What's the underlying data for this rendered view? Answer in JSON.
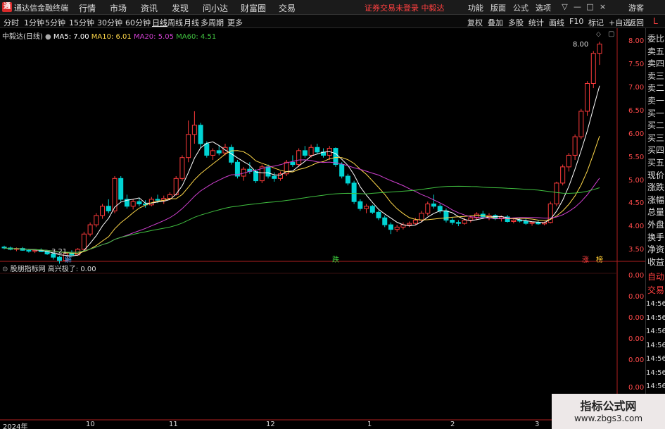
{
  "app": {
    "title": "通达信金融终端",
    "logo_text": "通"
  },
  "menu": [
    "行情",
    "市场",
    "资讯",
    "发现",
    "问小达",
    "财富圈",
    "交易"
  ],
  "notice": "证券交易未登录  中毅达",
  "right_menu": [
    "功能",
    "版面",
    "公式",
    "选项"
  ],
  "user": "游客",
  "window_controls": [
    "▽",
    "—",
    "□",
    "×"
  ],
  "periods": [
    "分时",
    "1分钟",
    "5分钟",
    "15分钟",
    "30分钟",
    "60分钟",
    "日线",
    "周线",
    "月线",
    "多周期",
    "更多"
  ],
  "toolbar": [
    "复权",
    "叠加",
    "多股",
    "统计",
    "画线",
    "F10",
    "标记",
    "+自选",
    "返回"
  ],
  "l_button": "L",
  "info": {
    "stock": "中毅达(日线)",
    "ma5": "MA5: 7.00",
    "ma10": "MA10: 6.01",
    "ma20": "MA20: 5.05",
    "ma60": "MA60: 4.51",
    "max_label": "8.00",
    "min_label": "3.21"
  },
  "price_axis": [
    "8.00",
    "7.50",
    "7.00",
    "6.50",
    "6.00",
    "5.50",
    "5.00",
    "4.50",
    "4.00",
    "3.50"
  ],
  "indicator": {
    "name": "股朋指标网",
    "value_text": "高兴极了: 0.00",
    "axis": [
      "0.00",
      "0.00",
      "0.00",
      "0.00",
      "0.00",
      "0.00"
    ]
  },
  "sidebar_top": [
    "委比",
    "卖五",
    "卖四",
    "卖三",
    "卖二",
    "卖一",
    "买一",
    "买二",
    "买三",
    "买四",
    "买五",
    "现价",
    "涨跌",
    "涨幅",
    "总量",
    "外盘",
    "换手",
    "净资",
    "收益"
  ],
  "sidebar_bottom": [
    "自动",
    "交易"
  ],
  "times": [
    "14:56",
    "14:56",
    "14:56",
    "14:56",
    "14:56",
    "14:56",
    "14:56",
    "14:56",
    "14:56"
  ],
  "dates": [
    "2024年",
    "10",
    "11",
    "12",
    "1",
    "2",
    "3"
  ],
  "markers": [
    {
      "text": "解",
      "color": "#4aa8ff"
    },
    {
      "text": "跌",
      "color": "#3ccc3c"
    },
    {
      "text": "涨",
      "color": "#ff4040"
    },
    {
      "text": "榜",
      "color": "#ffcc33"
    }
  ],
  "colors": {
    "up": "#ff3b3b",
    "down": "#00d4d4",
    "ma5": "#ffffff",
    "ma10": "#ffd84a",
    "ma20": "#d040d0",
    "ma60": "#40c040",
    "axis": "#ff4a4a"
  },
  "chart_data": {
    "type": "candlestick",
    "y_range": [
      3.2,
      8.05
    ],
    "candles": [
      [
        3.57,
        3.6,
        3.52,
        3.55
      ],
      [
        3.55,
        3.58,
        3.5,
        3.52
      ],
      [
        3.52,
        3.56,
        3.48,
        3.54
      ],
      [
        3.54,
        3.57,
        3.49,
        3.5
      ],
      [
        3.5,
        3.53,
        3.45,
        3.48
      ],
      [
        3.48,
        3.52,
        3.44,
        3.5
      ],
      [
        3.5,
        3.54,
        3.46,
        3.47
      ],
      [
        3.47,
        3.49,
        3.4,
        3.42
      ],
      [
        3.42,
        3.46,
        3.3,
        3.35
      ],
      [
        3.35,
        3.38,
        3.21,
        3.28
      ],
      [
        3.28,
        3.45,
        3.26,
        3.43
      ],
      [
        3.43,
        3.5,
        3.38,
        3.4
      ],
      [
        3.4,
        3.55,
        3.38,
        3.52
      ],
      [
        3.52,
        3.9,
        3.5,
        3.85
      ],
      [
        3.85,
        4.1,
        3.8,
        4.05
      ],
      [
        4.05,
        4.3,
        4.0,
        4.25
      ],
      [
        4.25,
        4.5,
        4.18,
        4.45
      ],
      [
        4.45,
        4.6,
        4.3,
        4.35
      ],
      [
        4.35,
        5.1,
        4.3,
        5.05
      ],
      [
        5.05,
        5.1,
        4.55,
        4.6
      ],
      [
        4.6,
        4.7,
        4.4,
        4.45
      ],
      [
        4.45,
        4.6,
        4.38,
        4.55
      ],
      [
        4.55,
        4.62,
        4.45,
        4.5
      ],
      [
        4.5,
        4.58,
        4.42,
        4.48
      ],
      [
        4.48,
        4.65,
        4.45,
        4.6
      ],
      [
        4.6,
        4.7,
        4.52,
        4.58
      ],
      [
        4.58,
        4.68,
        4.5,
        4.62
      ],
      [
        4.62,
        4.75,
        4.58,
        4.7
      ],
      [
        4.7,
        5.1,
        4.68,
        5.05
      ],
      [
        5.05,
        5.55,
        5.0,
        5.5
      ],
      [
        5.5,
        6.3,
        5.4,
        6.0
      ],
      [
        6.0,
        6.5,
        5.8,
        6.2
      ],
      [
        6.2,
        6.25,
        5.7,
        5.8
      ],
      [
        5.8,
        5.85,
        5.5,
        5.55
      ],
      [
        5.55,
        5.7,
        5.45,
        5.65
      ],
      [
        5.65,
        5.75,
        5.55,
        5.6
      ],
      [
        5.6,
        5.8,
        5.55,
        5.72
      ],
      [
        5.72,
        5.78,
        5.35,
        5.4
      ],
      [
        5.4,
        5.45,
        5.05,
        5.1
      ],
      [
        5.1,
        5.3,
        5.0,
        5.25
      ],
      [
        5.25,
        5.4,
        5.15,
        5.2
      ],
      [
        5.2,
        5.25,
        4.95,
        5.0
      ],
      [
        5.0,
        5.35,
        4.95,
        5.3
      ],
      [
        5.3,
        5.35,
        5.05,
        5.1
      ],
      [
        5.1,
        5.18,
        4.98,
        5.05
      ],
      [
        5.05,
        5.2,
        5.0,
        5.15
      ],
      [
        5.15,
        5.45,
        5.1,
        5.4
      ],
      [
        5.4,
        5.55,
        5.3,
        5.35
      ],
      [
        5.35,
        5.7,
        5.3,
        5.65
      ],
      [
        5.65,
        5.75,
        5.5,
        5.55
      ],
      [
        5.55,
        5.78,
        5.5,
        5.72
      ],
      [
        5.72,
        5.8,
        5.58,
        5.62
      ],
      [
        5.62,
        5.7,
        5.5,
        5.55
      ],
      [
        5.55,
        5.75,
        5.45,
        5.7
      ],
      [
        5.7,
        5.72,
        5.3,
        5.35
      ],
      [
        5.35,
        5.4,
        5.05,
        5.1
      ],
      [
        5.1,
        5.15,
        4.9,
        4.95
      ],
      [
        4.95,
        5.0,
        4.5,
        4.55
      ],
      [
        4.55,
        4.6,
        4.35,
        4.4
      ],
      [
        4.4,
        4.5,
        4.3,
        4.45
      ],
      [
        4.45,
        4.48,
        4.28,
        4.32
      ],
      [
        4.32,
        4.36,
        4.15,
        4.2
      ],
      [
        4.2,
        4.25,
        4.0,
        4.05
      ],
      [
        4.05,
        4.1,
        3.85,
        3.95
      ],
      [
        3.95,
        4.05,
        3.9,
        4.0
      ],
      [
        4.0,
        4.1,
        3.95,
        4.05
      ],
      [
        4.05,
        4.12,
        4.0,
        4.08
      ],
      [
        4.08,
        4.2,
        4.05,
        4.15
      ],
      [
        4.15,
        4.35,
        4.1,
        4.3
      ],
      [
        4.3,
        4.55,
        4.25,
        4.5
      ],
      [
        4.5,
        4.7,
        4.4,
        4.45
      ],
      [
        4.45,
        4.5,
        4.3,
        4.35
      ],
      [
        4.35,
        4.4,
        4.1,
        4.15
      ],
      [
        4.15,
        4.2,
        4.05,
        4.1
      ],
      [
        4.1,
        4.15,
        4.02,
        4.08
      ],
      [
        4.08,
        4.2,
        4.05,
        4.15
      ],
      [
        4.15,
        4.25,
        4.1,
        4.2
      ],
      [
        4.2,
        4.32,
        4.15,
        4.28
      ],
      [
        4.28,
        4.35,
        4.18,
        4.22
      ],
      [
        4.22,
        4.3,
        4.15,
        4.25
      ],
      [
        4.25,
        4.28,
        4.15,
        4.18
      ],
      [
        4.18,
        4.25,
        4.12,
        4.22
      ],
      [
        4.22,
        4.26,
        4.1,
        4.12
      ],
      [
        4.12,
        4.18,
        4.08,
        4.15
      ],
      [
        4.15,
        4.2,
        4.1,
        4.13
      ],
      [
        4.13,
        4.18,
        4.05,
        4.08
      ],
      [
        4.08,
        4.12,
        4.03,
        4.1
      ],
      [
        4.1,
        4.15,
        4.05,
        4.07
      ],
      [
        4.07,
        4.12,
        4.04,
        4.1
      ],
      [
        4.1,
        4.55,
        4.08,
        4.5
      ],
      [
        4.5,
        4.98,
        4.45,
        4.95
      ],
      [
        4.95,
        5.35,
        4.9,
        5.3
      ],
      [
        5.3,
        5.6,
        5.2,
        5.55
      ],
      [
        5.55,
        6.0,
        5.45,
        5.95
      ],
      [
        5.95,
        6.55,
        5.9,
        6.5
      ],
      [
        6.5,
        7.15,
        6.4,
        7.1
      ],
      [
        7.1,
        7.8,
        7.0,
        7.75
      ],
      [
        7.75,
        8.0,
        7.5,
        7.95
      ]
    ]
  }
}
